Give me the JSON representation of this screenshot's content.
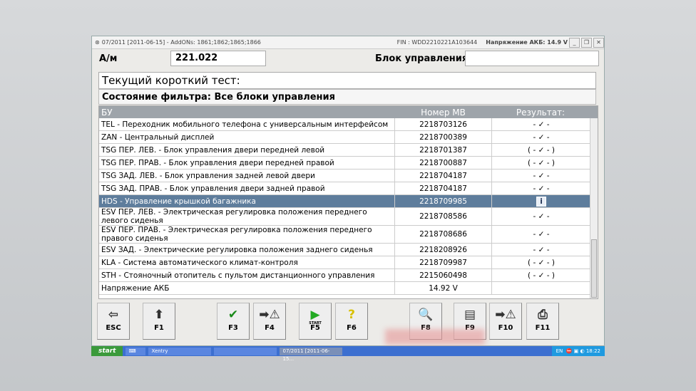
{
  "window": {
    "title": "07/2011 [2011-06-15] - AddONs: 1861;1862;1865;1866",
    "fin": "FIN : WDD2210221A103644",
    "voltage": "Напряжение АКБ: 14.9 V"
  },
  "vehicle": {
    "label": "А/м",
    "value": "221.022",
    "ecu_label": "Блок управления",
    "ecu_value": ""
  },
  "test_title": "Текущий короткий тест:",
  "filter": "Состояние фильтра: Все блоки управления",
  "table": {
    "headers": [
      "БУ",
      "Номер МВ",
      "Результат:"
    ],
    "rows": [
      {
        "name": "TEL - Переходник мобильного телефона с универсальным интерфейсом",
        "number": "2218703126",
        "result": "- ✓ -"
      },
      {
        "name": "ZAN - Центральный дисплей",
        "number": "2218700389",
        "result": "- ✓ -"
      },
      {
        "name": "TSG ПЕР. ЛЕВ. - Блок управления двери передней левой",
        "number": "2218701387",
        "result": "( - ✓ - )"
      },
      {
        "name": "TSG ПЕР. ПРАВ. - Блок управления двери передней правой",
        "number": "2218700887",
        "result": "( - ✓ - )"
      },
      {
        "name": "TSG ЗАД. ЛЕВ. - Блок управления задней левой двери",
        "number": "2218704187",
        "result": "- ✓ -"
      },
      {
        "name": "TSG ЗАД. ПРАВ. - Блок управления двери задней правой",
        "number": "2218704187",
        "result": "- ✓ -"
      },
      {
        "name": "HDS - Управление крышкой багажника",
        "number": "2218709985",
        "result": "i"
      },
      {
        "name": "ESV ПЕР. ЛЕВ. - Электрическая регулировка положения переднего левого сиденья",
        "number": "2218708586",
        "result": "- ✓ -"
      },
      {
        "name": "ESV ПЕР. ПРАВ. - Электрическая регулировка положения переднего правого сиденья",
        "number": "2218708686",
        "result": "- ✓ -"
      },
      {
        "name": "ESV ЗАД. - Электрические регулировка положения заднего сиденья",
        "number": "2218208926",
        "result": "- ✓ -"
      },
      {
        "name": "KLA - Система автоматического климат-контроля",
        "number": "2218709987",
        "result": "( - ✓ - )"
      },
      {
        "name": "STH - Стояночный отопитель с пультом дистанционного управления",
        "number": "2215060498",
        "result": "( - ✓ - )"
      },
      {
        "name": "Напряжение АКБ",
        "number": "14.92 V",
        "result": ""
      }
    ]
  },
  "fkeys": [
    {
      "label": "ESC",
      "icon": "exit-door-icon",
      "glyph": "⇦"
    },
    {
      "label": "F1",
      "icon": "arrow-up-icon",
      "glyph": "⬆"
    },
    {
      "label": "F3",
      "icon": "checkmark-icon",
      "glyph": "✔"
    },
    {
      "label": "F4",
      "icon": "warning-transfer-icon",
      "glyph": "➡⚠"
    },
    {
      "label": "F5",
      "icon": "start-icon",
      "glyph": "▶"
    },
    {
      "label": "F6",
      "icon": "help-icon",
      "glyph": "?"
    },
    {
      "label": "F8",
      "icon": "magnifier-icon",
      "glyph": "🔍"
    },
    {
      "label": "F9",
      "icon": "color-document-icon",
      "glyph": "▤"
    },
    {
      "label": "F10",
      "icon": "fault-transfer-icon",
      "glyph": "➡⚠"
    },
    {
      "label": "F11",
      "icon": "printer-icon",
      "glyph": "⎙"
    }
  ],
  "start_sub": "START",
  "taskbar": {
    "start": "start",
    "tasks": [
      "Xentry",
      "",
      "07/2011 [2011-06-15..."
    ],
    "lang": "EN",
    "time": "18:22"
  }
}
